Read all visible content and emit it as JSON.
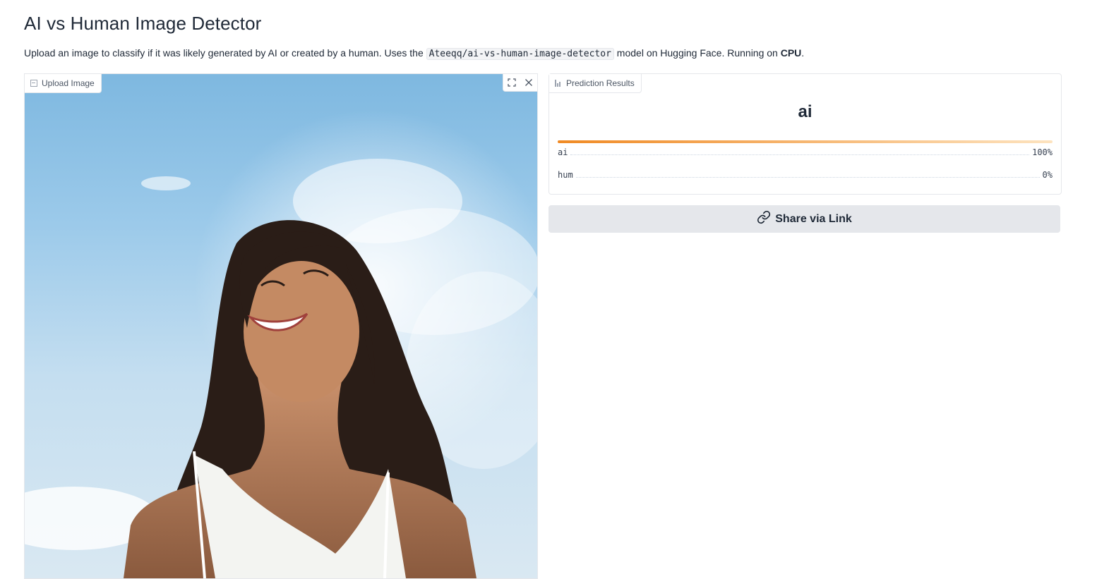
{
  "page": {
    "title": "AI vs Human Image Detector",
    "description": {
      "part1": "Upload an image to classify if it was likely generated by AI or created by a human. Uses the ",
      "model": "Ateeqq/ai-vs-human-image-detector",
      "part2": " model on Hugging Face. Running on ",
      "device": "CPU",
      "part3": "."
    }
  },
  "upload": {
    "label": "Upload Image",
    "label_icon": "image-icon",
    "tools": [
      {
        "name": "fullscreen-icon",
        "glyph": "⛶"
      },
      {
        "name": "close-icon",
        "glyph": "✕"
      }
    ]
  },
  "results": {
    "label": "Prediction Results",
    "label_icon": "bar-chart-icon",
    "top_label": "ai",
    "confidences": [
      {
        "label": "ai",
        "percent_text": "100%",
        "value": 1.0
      },
      {
        "label": "hum",
        "percent_text": "0%",
        "value": 0.0
      }
    ],
    "bar_color_start": "#f08a24",
    "bar_color_end": "#fde3bf"
  },
  "share": {
    "label": "Share via Link",
    "icon": "link-icon"
  }
}
